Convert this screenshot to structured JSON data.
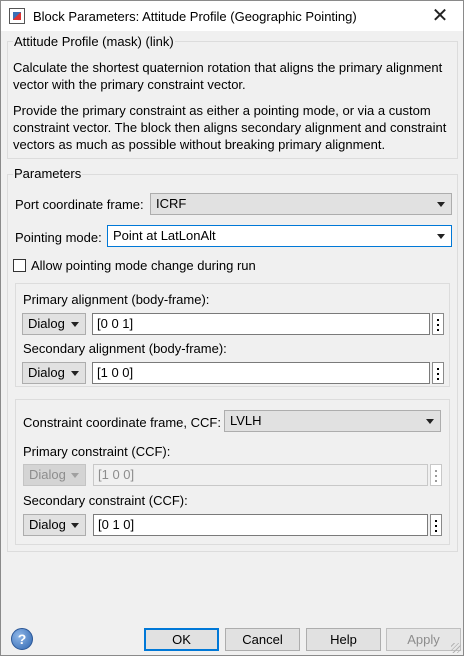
{
  "window": {
    "title": "Block Parameters: Attitude Profile (Geographic Pointing)",
    "close_glyph": "✕"
  },
  "mask": {
    "group_label": "Attitude Profile (mask) (link)",
    "description_1": [
      "Calculate the shortest quaternion rotation that aligns the primary alignment",
      "vector with the primary constraint vector."
    ],
    "description_2": [
      "Provide the primary constraint as either a pointing mode, or via a custom",
      "constraint vector. The block then aligns secondary alignment and constraint",
      "vectors as much as possible without breaking primary alignment."
    ]
  },
  "parameters": {
    "group_label": "Parameters",
    "port_frame": {
      "label": "Port coordinate frame:",
      "value": "ICRF"
    },
    "pointing_mode": {
      "label": "Pointing mode:",
      "value": "Point at LatLonAlt"
    },
    "allow_change": {
      "label": "Allow pointing mode change during run",
      "checked": false
    },
    "primary_alignment": {
      "label": "Primary alignment (body-frame):",
      "source": "Dialog",
      "value": "[0 0 1]"
    },
    "secondary_alignment": {
      "label": "Secondary alignment (body-frame):",
      "source": "Dialog",
      "value": "[1 0 0]"
    },
    "ccf": {
      "label": "Constraint coordinate frame, CCF:",
      "value": "LVLH"
    },
    "primary_constraint": {
      "label": "Primary constraint (CCF):",
      "source": "Dialog",
      "value": "[1 0 0]",
      "enabled": false
    },
    "secondary_constraint": {
      "label": "Secondary constraint (CCF):",
      "source": "Dialog",
      "value": "[0 1 0]"
    }
  },
  "buttons": {
    "ok": "OK",
    "cancel": "Cancel",
    "help": "Help",
    "apply": "Apply",
    "help_glyph": "?"
  },
  "colors": {
    "accent": "#0078d7",
    "window_bg": "#f0f0f0"
  }
}
